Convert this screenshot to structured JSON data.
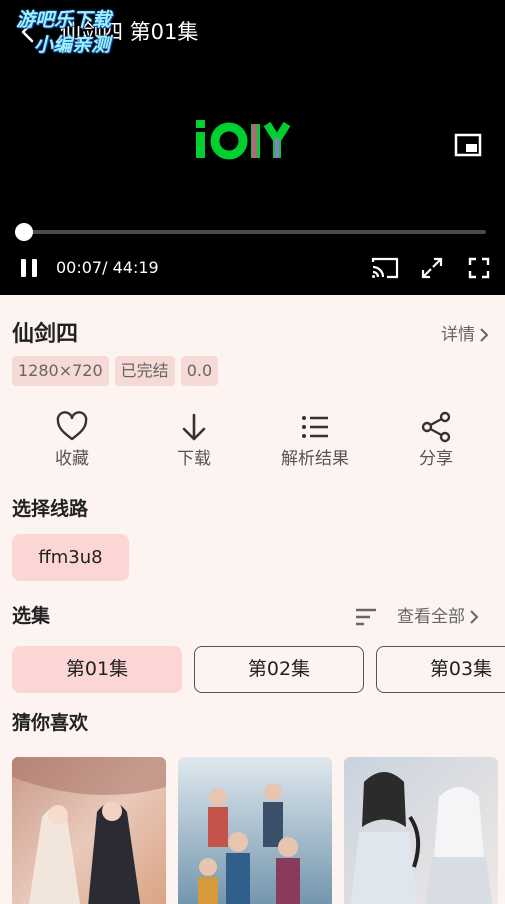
{
  "player": {
    "title": "仙剑四 第01集",
    "watermark_line1": "游吧乐下载",
    "watermark_line2": "小编亲测",
    "current_time": "00:07",
    "duration": "44:19",
    "time_separator": "/",
    "progress": 0.003,
    "logo_text": "iQIYI"
  },
  "show": {
    "title": "仙剑四",
    "detail_label": "详情",
    "tags": [
      "1280×720",
      "已完结",
      "0.0"
    ]
  },
  "actions": [
    {
      "label": "收藏",
      "icon": "heart-icon"
    },
    {
      "label": "下载",
      "icon": "download-arrow-icon"
    },
    {
      "label": "解析结果",
      "icon": "list-icon"
    },
    {
      "label": "分享",
      "icon": "share-icon"
    }
  ],
  "routes": {
    "title": "选择线路",
    "items": [
      "ffm3u8"
    ]
  },
  "episodes": {
    "title": "选集",
    "view_all_label": "查看全部",
    "items": [
      "第01集",
      "第02集",
      "第03集"
    ],
    "selected": "第01集"
  },
  "recommend": {
    "title": "猜你喜欢"
  },
  "colors": {
    "background": "#fdf3f1",
    "accent": "#fcd6d4",
    "tag_bg": "#f5dad6"
  }
}
